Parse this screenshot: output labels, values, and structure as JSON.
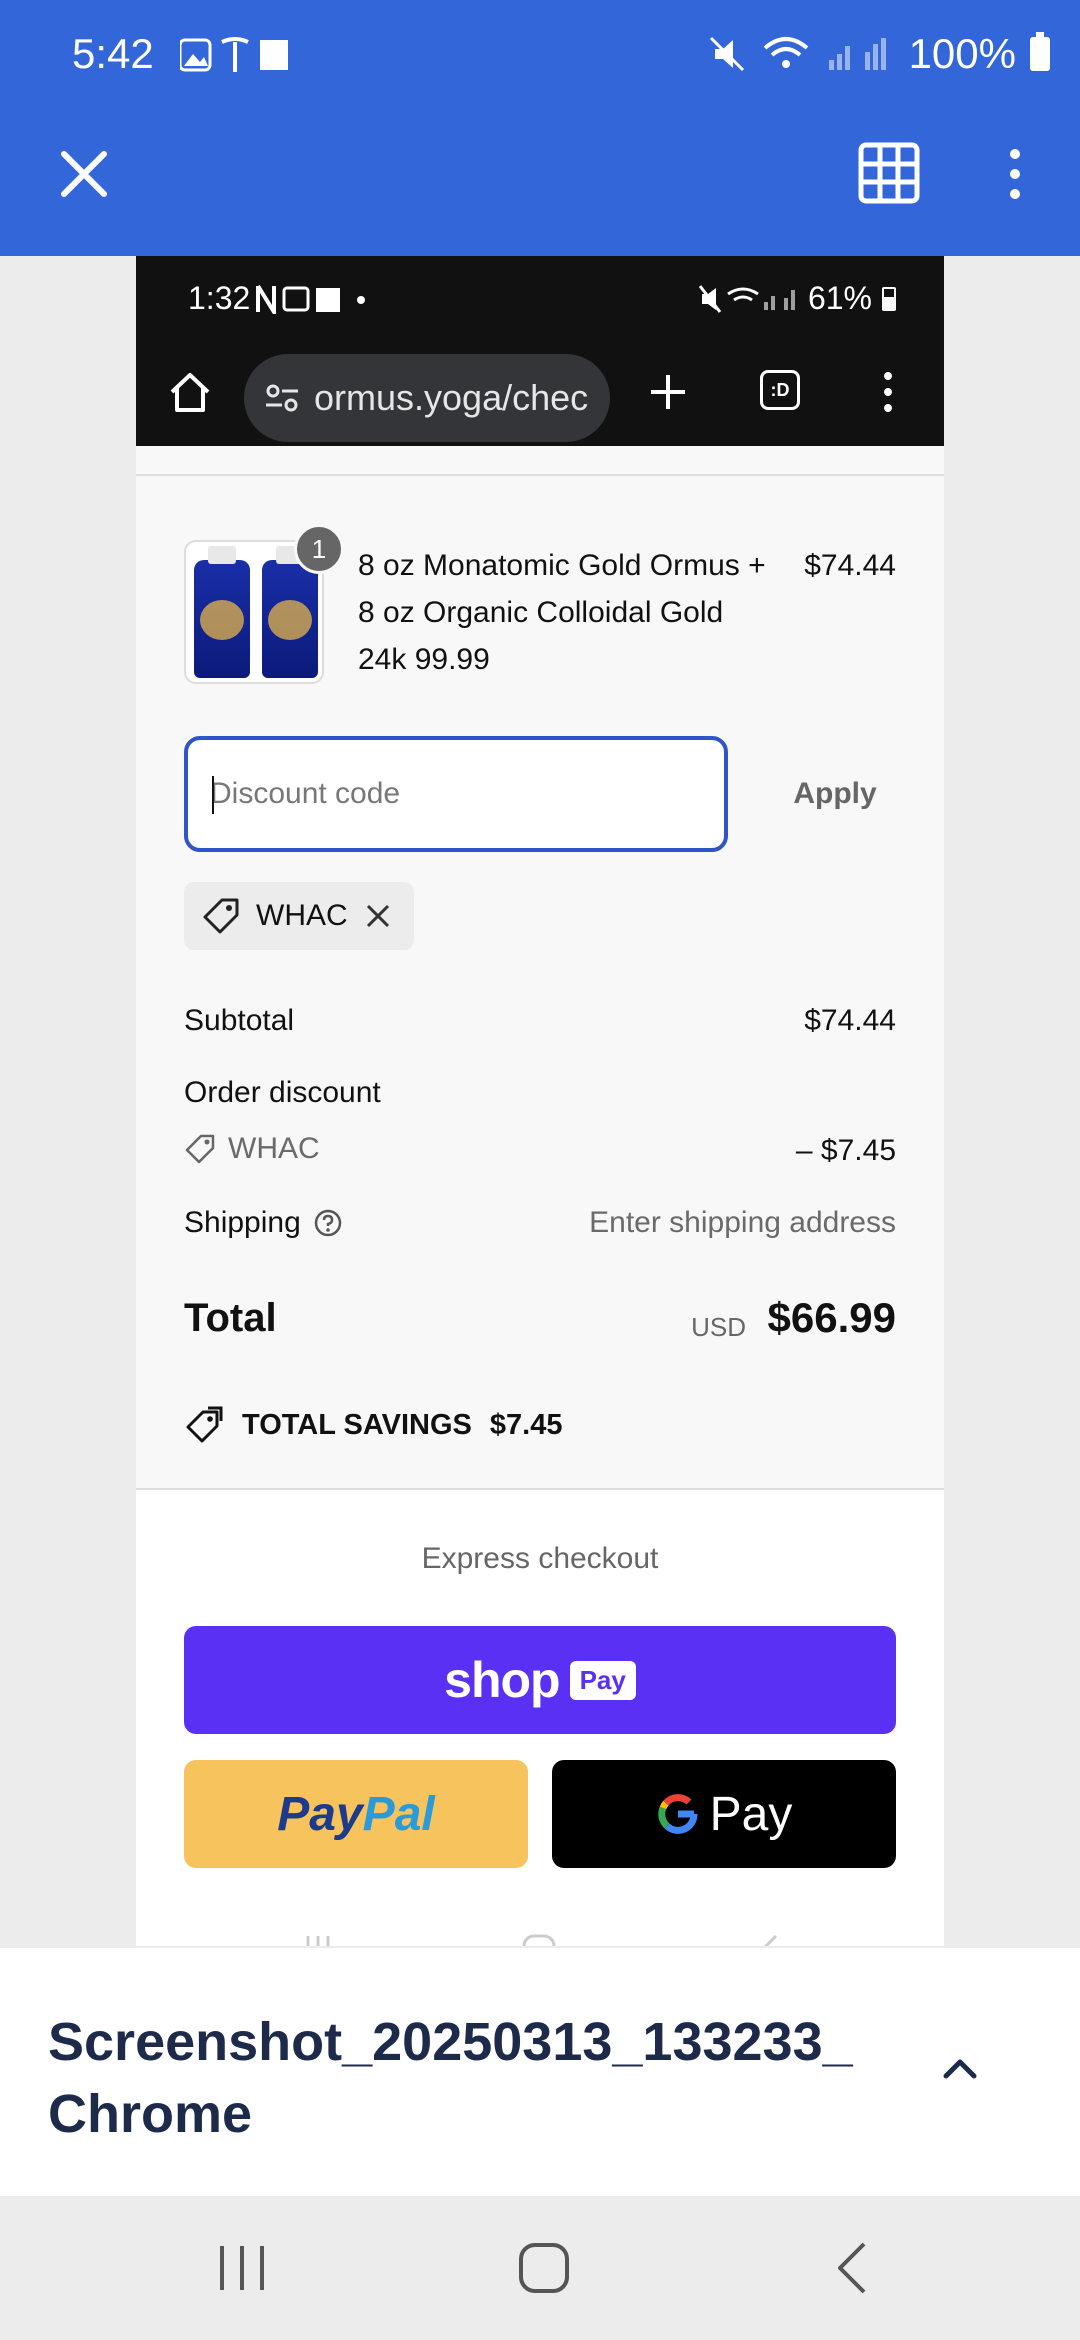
{
  "outer_status": {
    "time": "5:42",
    "battery": "100%"
  },
  "inner_status": {
    "time": "1:32",
    "battery": "61%"
  },
  "browser": {
    "url": "ormus.yoga/chec",
    "tab_count": ":D"
  },
  "order": {
    "product": {
      "quantity": "1",
      "title": "8 oz Monatomic Gold Ormus + 8 oz Organic Colloidal Gold 24k 99.99",
      "price": "$74.44"
    },
    "discount_placeholder": "Discount code",
    "apply_label": "Apply",
    "applied_code": "WHAC",
    "subtotal_label": "Subtotal",
    "subtotal_value": "$74.44",
    "order_discount_label": "Order discount",
    "discount_code": "WHAC",
    "discount_value": "– $7.45",
    "shipping_label": "Shipping",
    "shipping_value": "Enter shipping address",
    "total_label": "Total",
    "total_currency": "USD",
    "total_value": "$66.99",
    "savings_label": "TOTAL SAVINGS",
    "savings_value": "$7.45"
  },
  "express": {
    "label": "Express checkout",
    "shop_word": "shop",
    "shop_pay_pill": "Pay",
    "paypal_part1": "Pay",
    "paypal_part2": "Pal",
    "gpay_label": "Pay"
  },
  "file_sheet": {
    "name": "Screenshot_20250313_133233_Chrome"
  },
  "colors": {
    "header_blue": "#3366d9",
    "shop_pay": "#5a31f4",
    "paypal_yellow": "#f7c35c",
    "focus_blue": "#2f54c7"
  }
}
